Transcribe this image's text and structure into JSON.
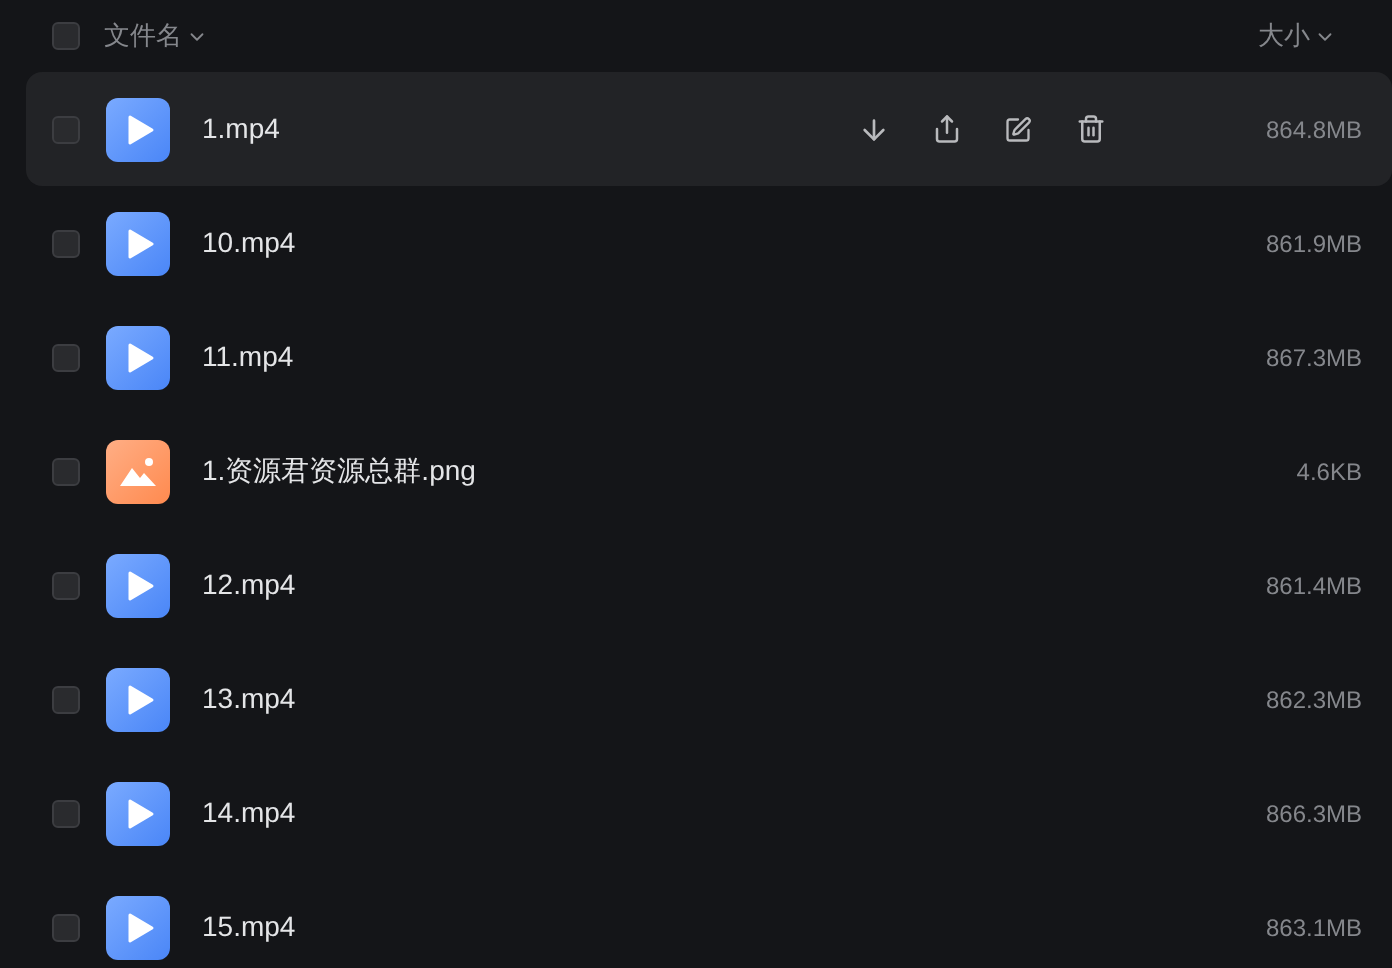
{
  "header": {
    "checked": false,
    "name_column": "文件名",
    "size_column": "大小"
  },
  "files": [
    {
      "kind": "video",
      "name": "1.mp4",
      "size": "864.8MB",
      "checked": false,
      "hovered": true
    },
    {
      "kind": "video",
      "name": "10.mp4",
      "size": "861.9MB",
      "checked": false,
      "hovered": false
    },
    {
      "kind": "video",
      "name": "11.mp4",
      "size": "867.3MB",
      "checked": false,
      "hovered": false
    },
    {
      "kind": "image",
      "name": "1.资源君资源总群.png",
      "size": "4.6KB",
      "checked": false,
      "hovered": false
    },
    {
      "kind": "video",
      "name": "12.mp4",
      "size": "861.4MB",
      "checked": false,
      "hovered": false
    },
    {
      "kind": "video",
      "name": "13.mp4",
      "size": "862.3MB",
      "checked": false,
      "hovered": false
    },
    {
      "kind": "video",
      "name": "14.mp4",
      "size": "866.3MB",
      "checked": false,
      "hovered": false
    },
    {
      "kind": "video",
      "name": "15.mp4",
      "size": "863.1MB",
      "checked": false,
      "hovered": false
    }
  ]
}
